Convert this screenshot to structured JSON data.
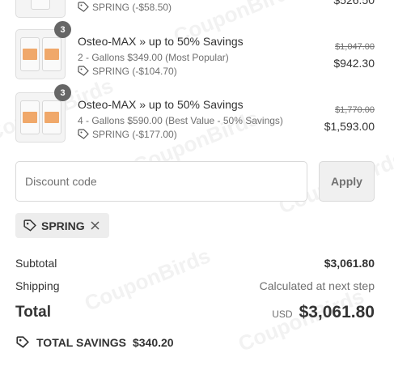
{
  "items": [
    {
      "discount": "SPRING (-$58.50)",
      "price": "$526.50"
    },
    {
      "quantity": "3",
      "title": "Osteo-MAX » up to 50% Savings",
      "variant": "2 - Gallons $349.00 (Most Popular)",
      "discount": "SPRING (-$104.70)",
      "compare_price": "$1,047.00",
      "price": "$942.30"
    },
    {
      "quantity": "3",
      "title": "Osteo-MAX » up to 50% Savings",
      "variant": "4 - Gallons $590.00 (Best Value - 50% Savings)",
      "discount": "SPRING (-$177.00)",
      "compare_price": "$1,770.00",
      "price": "$1,593.00"
    }
  ],
  "discount_form": {
    "placeholder": "Discount code",
    "apply_label": "Apply"
  },
  "applied_code": "SPRING",
  "summary": {
    "subtotal_label": "Subtotal",
    "subtotal_value": "$3,061.80",
    "shipping_label": "Shipping",
    "shipping_value": "Calculated at next step",
    "total_label": "Total",
    "currency": "USD",
    "total_value": "$3,061.80",
    "savings_label": "TOTAL SAVINGS",
    "savings_value": "$340.20"
  },
  "watermark": "CouponBirds",
  "icons": {
    "tag": "tag-icon",
    "remove": "close-icon",
    "savings": "savings-tag-icon"
  }
}
